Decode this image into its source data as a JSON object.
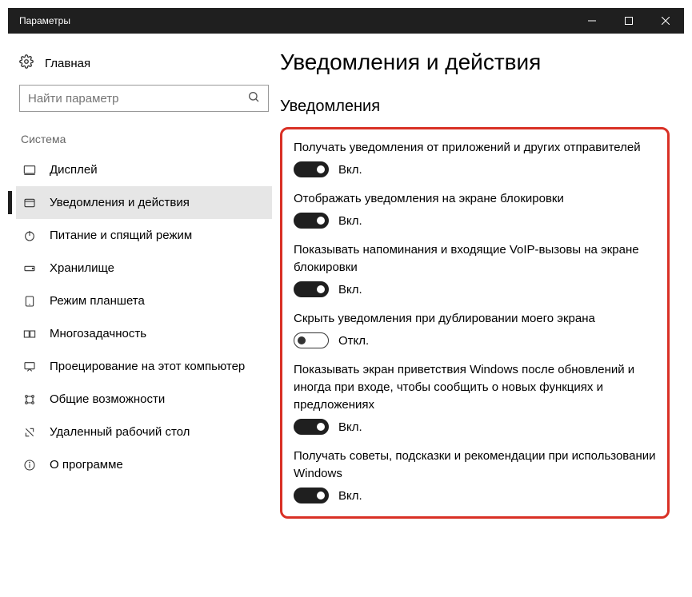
{
  "window": {
    "title": "Параметры"
  },
  "sidebar": {
    "home": "Главная",
    "search_placeholder": "Найти параметр",
    "category": "Система",
    "items": [
      {
        "label": "Дисплей"
      },
      {
        "label": "Уведомления и действия"
      },
      {
        "label": "Питание и спящий режим"
      },
      {
        "label": "Хранилище"
      },
      {
        "label": "Режим планшета"
      },
      {
        "label": "Многозадачность"
      },
      {
        "label": "Проецирование на этот компьютер"
      },
      {
        "label": "Общие возможности"
      },
      {
        "label": "Удаленный рабочий стол"
      },
      {
        "label": "О программе"
      }
    ]
  },
  "main": {
    "title": "Уведомления и действия",
    "section": "Уведомления",
    "settings": [
      {
        "label": "Получать уведомления от приложений и других отправителей",
        "state": "on",
        "text": "Вкл."
      },
      {
        "label": "Отображать уведомления на экране блокировки",
        "state": "on",
        "text": "Вкл."
      },
      {
        "label": "Показывать напоминания и входящие VoIP-вызовы на экране блокировки",
        "state": "on",
        "text": "Вкл."
      },
      {
        "label": "Скрыть уведомления при дублировании моего экрана",
        "state": "off",
        "text": "Откл."
      },
      {
        "label": "Показывать экран приветствия Windows после обновлений и иногда при входе, чтобы сообщить о новых функциях и предложениях",
        "state": "on",
        "text": "Вкл."
      },
      {
        "label": "Получать советы, подсказки и рекомендации при использовании Windows",
        "state": "on",
        "text": "Вкл."
      }
    ]
  }
}
